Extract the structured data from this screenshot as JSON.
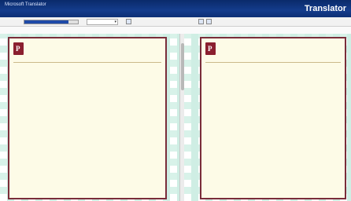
{
  "header": {
    "app_title": "Microsoft Translator",
    "sub_title": "",
    "mid_text": "",
    "brand_pre": "",
    "brand": "Translator"
  },
  "toolbar": {
    "label": "",
    "progress_fraction": 0.82,
    "dropdown_value": "",
    "from_text": "",
    "to_text": "",
    "zoom_text": ""
  },
  "subbar": {
    "left": "",
    "right": ""
  },
  "left_card": {
    "title": "",
    "lines": [
      "",
      ""
    ],
    "entries": [
      {
        "cite": "",
        "link": "",
        "link_line": "",
        "snippets": []
      },
      {
        "cite": "",
        "link": "",
        "link_line": "",
        "snippets": [
          "",
          "",
          ""
        ]
      },
      {
        "cite": "",
        "link": "",
        "link_line": "",
        "snippets": [
          "",
          "",
          ""
        ]
      },
      {
        "cite": "",
        "link": "",
        "link_line": "",
        "snippets": [
          "",
          "",
          ""
        ]
      },
      {
        "cite": "",
        "link": "",
        "link_line": "",
        "snippets": [
          "",
          ""
        ]
      }
    ]
  },
  "right_card": {
    "lines": [
      "",
      "",
      ""
    ],
    "entries": [
      {
        "cite": "",
        "link": "",
        "snippets": [
          "",
          "",
          ""
        ]
      },
      {
        "cite": "",
        "link": "",
        "snippets": [
          "",
          "",
          ""
        ]
      },
      {
        "cite": "",
        "link": "",
        "snippets": [
          "",
          "",
          "",
          ""
        ]
      },
      {
        "cite": "",
        "link": "",
        "snippets": [
          "",
          "",
          ""
        ]
      },
      {
        "cite": "",
        "link": "",
        "snippets": [
          "",
          ""
        ]
      }
    ]
  },
  "colors": {
    "header_bg": "#143c8c",
    "card_border": "#7a2d3a",
    "card_bg": "#fdfbe7",
    "cite_green": "#0d7a35",
    "link_blue": "#1a3fd0",
    "grid_teal": "#cfeee4"
  },
  "icons": {
    "logo": "translator-logo-icon",
    "dropdown": "chevron-down-icon",
    "swap": "swap-icon",
    "view": "split-view-icon"
  }
}
